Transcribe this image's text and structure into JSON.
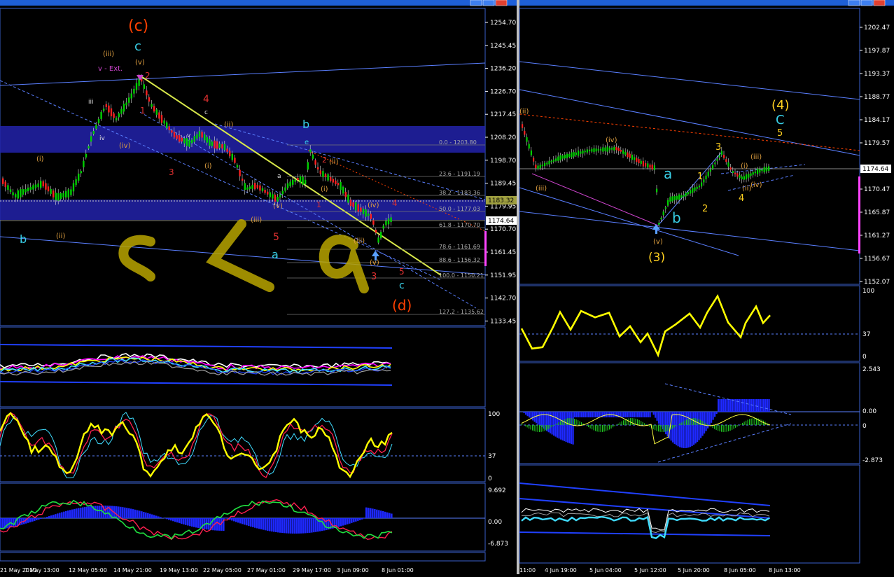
{
  "colors": {
    "background": "#000000",
    "frame": "#3a5fcd",
    "window_blue": "#1e5fd8",
    "candle_up": "#00d000",
    "candle_down": "#ff2020",
    "zone": "#2222aa",
    "channel": "#5a7fff",
    "trend_yellow": "#d8e84a",
    "osc_yellow": "#ffff00",
    "osc_cyan": "#3fdcff",
    "histogram": "#1e28ff",
    "wave_orange": "#ff4000",
    "wave_cyan": "#39d0e8",
    "wave_tan": "#e0a040",
    "wave_yellow": "#ffd020",
    "wave_red": "#e03030",
    "drawing_olive": "#b8a400"
  },
  "icons": {
    "collapse_marker": "triangle-down-icon",
    "window_controls": [
      "minimize-icon",
      "maximize-icon",
      "close-icon"
    ],
    "price_arrow": "arrow-up-icon"
  },
  "left_chart": {
    "price_axis": [
      "1254.70",
      "1245.45",
      "1236.20",
      "1226.70",
      "1217.45",
      "1208.20",
      "1198.70",
      "1189.45",
      "1179.95",
      "1170.70",
      "1161.45",
      "1151.95",
      "1142.70",
      "1133.45"
    ],
    "current_price": "1174.64",
    "marked_price": "1183.32",
    "fib_levels": [
      {
        "label": "0.0 - 1203.80"
      },
      {
        "label": "23.6 - 1191.19"
      },
      {
        "label": "38.2 - 1183.36"
      },
      {
        "label": "50.0 - 1177.03"
      },
      {
        "label": "61.8 - 1170.70"
      },
      {
        "label": "78.6 - 1161.69"
      },
      {
        "label": "88.6 - 1156.32"
      },
      {
        "label": "100.0 - 1150.21"
      },
      {
        "label": "127.2 - 1135.62"
      }
    ],
    "time_axis": [
      "21 May 2010",
      "7 May 13:00",
      "12 May 05:00",
      "14 May 21:00",
      "19 May 13:00",
      "22 May 05:00",
      "27 May 01:00",
      "29 May 17:00",
      "3 Jun 09:00",
      "8 Jun 01:00"
    ],
    "wave_labels": {
      "c_paren": "(c)",
      "d_paren": "(d)",
      "c_cyan": "c",
      "c_cyan_bottom": "c",
      "b_cyan": "b",
      "b_cyan_left": "b",
      "a_cyan": "a",
      "iii_top": "(iii)",
      "v_ext": "v - Ext.",
      "v_paren": "(v)",
      "iv_paren": "(iv)",
      "ii_paren": "(ii)",
      "i_paren": "(i)",
      "ii_paren_left": "(ii)",
      "i_paren_left": "(i)",
      "iii_paren_low": "(iii)",
      "v_paren_low": "(v)",
      "i_paren_mid": "(i)",
      "ii_paren_mid": "(ii)",
      "iv_paren_right": "(iv)",
      "iii_paren_right": "(iii)",
      "v_paren_right": "(v)",
      "red_1": "1",
      "red_2": "2",
      "red_3": "3",
      "red_4": "4",
      "red_5": "5",
      "red_1b": "1",
      "red_2b": "2",
      "red_3b": "3",
      "red_4b": "4",
      "red_5b": "5",
      "e_cyan": "e",
      "white_iii": "iii",
      "white_iv": "iv",
      "white_v": "v",
      "white_c": "c",
      "white_a": "a"
    },
    "osc1_axis": [
      "100",
      "37",
      "0"
    ],
    "osc2_axis": [
      "9.692",
      "0.00",
      "-6.873"
    ]
  },
  "right_chart": {
    "price_axis": [
      "1202.47",
      "1197.87",
      "1193.37",
      "1188.77",
      "1184.17",
      "1179.57",
      "1174.64",
      "1170.47",
      "1165.87",
      "1161.27",
      "1156.67",
      "1152.07"
    ],
    "current_price": "1174.64",
    "time_axis": [
      "11:00",
      "4 Jun 19:00",
      "5 Jun 04:00",
      "5 Jun 12:00",
      "5 Jun 20:00",
      "8 Jun 05:00",
      "8 Jun 13:00"
    ],
    "wave_labels": {
      "four_paren": "(4)",
      "c_cyan": "C",
      "five_yellow": "5",
      "three_yellow": "3",
      "two_yellow": "2",
      "one_yellow": "1",
      "four_yellow": "4",
      "three_paren": "(3)",
      "a_cyan": "a",
      "b_cyan": "b",
      "iv_paren": "(iv)",
      "iii_paren": "(iii)",
      "ii_paren": "(ii)",
      "v_paren": "(v)",
      "i_paren": "(i)",
      "ii_paren2": "(ii)",
      "iii_paren2": "(iii)",
      "iv_paren2": "(iv)"
    },
    "osc1_axis": [
      "100",
      "37",
      "0"
    ],
    "osc2_axis": [
      "2.543",
      "0.00",
      "0",
      "-2.873"
    ]
  }
}
